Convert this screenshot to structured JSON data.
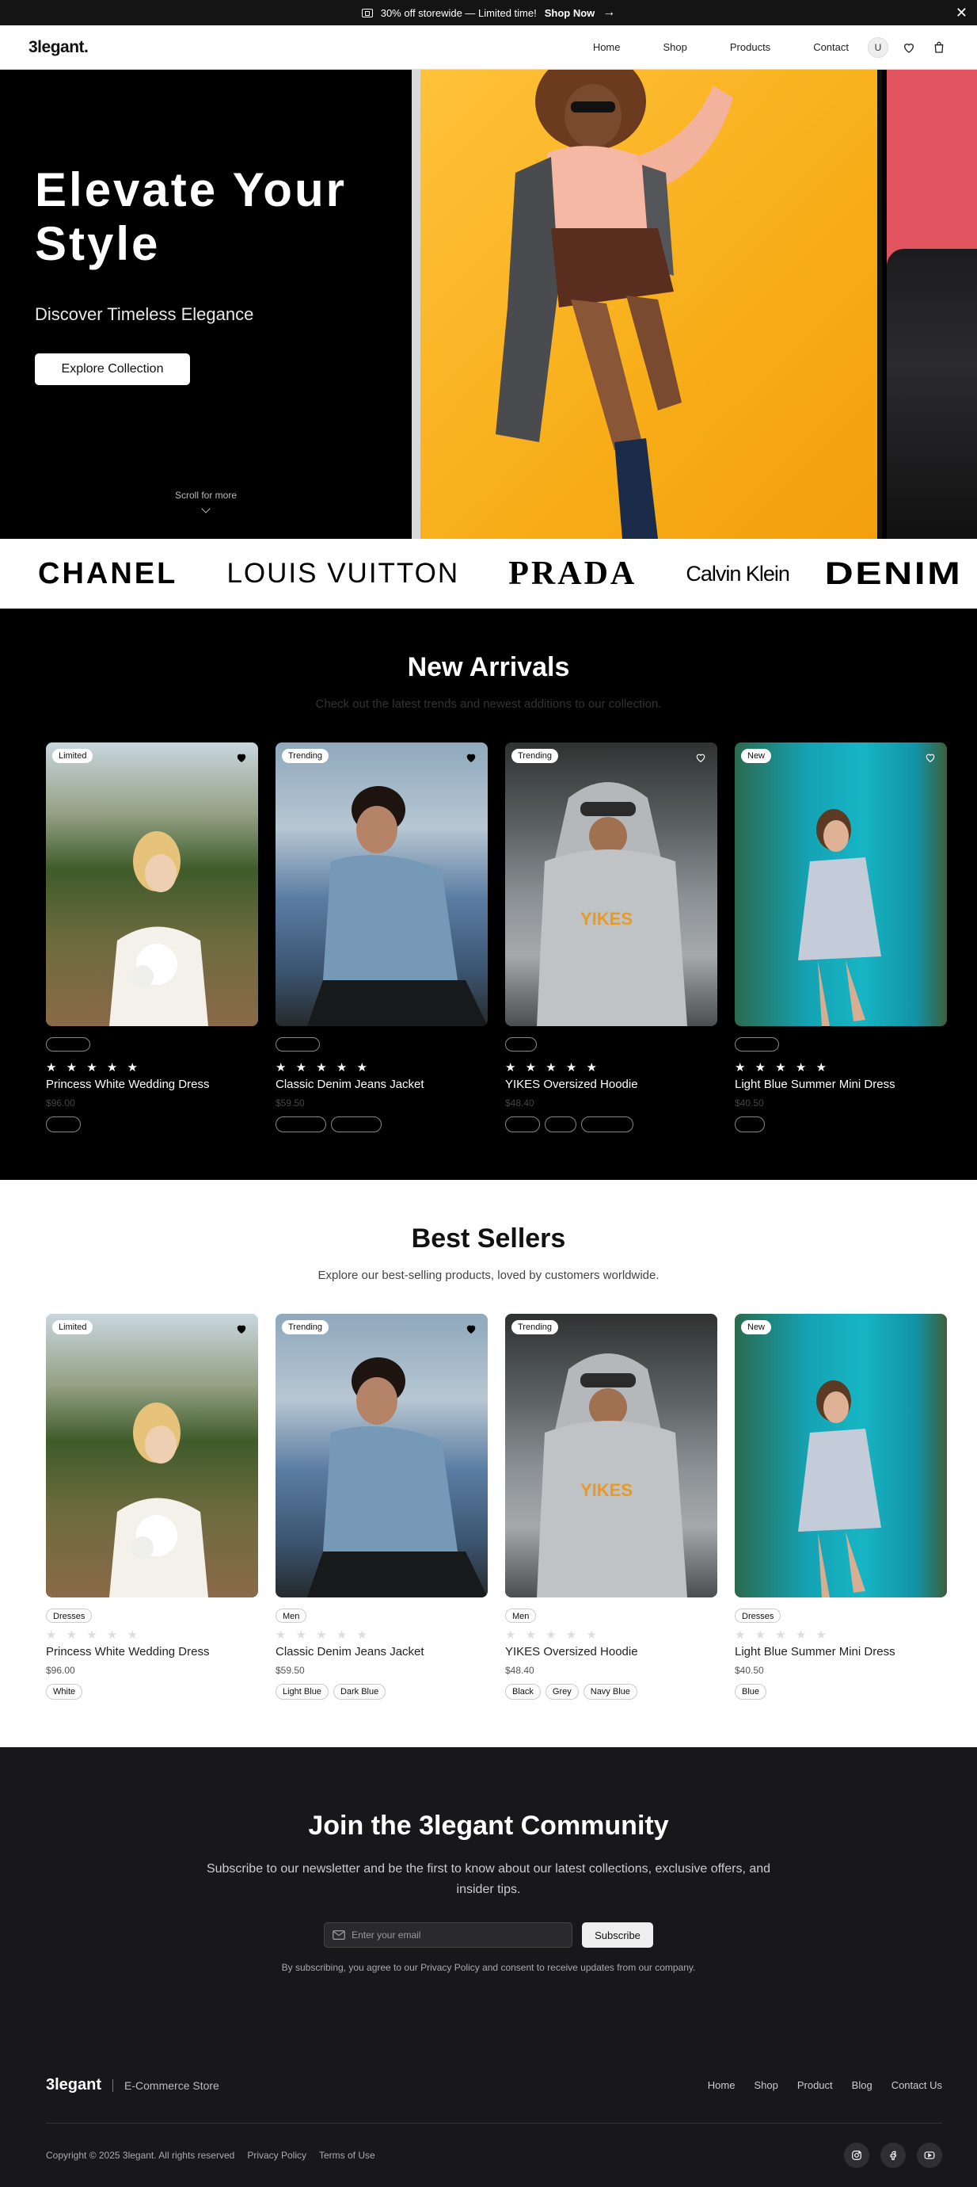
{
  "announcement": {
    "text": "30% off storewide — Limited time!",
    "link": "Shop Now",
    "arrow": "→",
    "close": "✕"
  },
  "nav": {
    "logo": "3legant.",
    "links": [
      "Home",
      "Shop",
      "Products",
      "Contact"
    ],
    "avatar": "U"
  },
  "hero": {
    "title": "Elevate Your Style",
    "subtitle": "Discover Timeless Elegance",
    "button": "Explore Collection",
    "scroll": "Scroll for more"
  },
  "brands": [
    "CHANEL",
    "LOUIS VUITTON",
    "PRADA",
    "Calvin Klein",
    "DENIM"
  ],
  "new_arrivals": {
    "title": "New Arrivals",
    "subtitle": "Check out the latest trends and newest additions to our collection.",
    "stars": "★ ★ ★ ★ ★",
    "products": [
      {
        "badge": "Limited",
        "name": "Princess White Wedding Dress",
        "price": "$96.00",
        "colors": 1
      },
      {
        "badge": "Trending",
        "name": "Classic Denim Jeans Jacket",
        "price": "$59.50",
        "colors": 2
      },
      {
        "badge": "Trending",
        "name": "YIKES Oversized Hoodie",
        "price": "$48.40",
        "colors": 3
      },
      {
        "badge": "New",
        "name": "Light Blue Summer Mini Dress",
        "price": "$40.50",
        "colors": 1
      }
    ]
  },
  "best_sellers": {
    "title": "Best Sellers",
    "subtitle": "Explore our best-selling products, loved by customers worldwide.",
    "stars": "★ ★ ★ ★ ★",
    "products": [
      {
        "badge": "Limited",
        "category": "Dresses",
        "name": "Princess White Wedding Dress",
        "price": "$96.00",
        "colors": [
          "White"
        ]
      },
      {
        "badge": "Trending",
        "category": "Men",
        "name": "Classic Denim Jeans Jacket",
        "price": "$59.50",
        "colors": [
          "Light Blue",
          "Dark Blue"
        ]
      },
      {
        "badge": "Trending",
        "category": "Men",
        "name": "YIKES Oversized Hoodie",
        "price": "$48.40",
        "colors": [
          "Black",
          "Grey",
          "Navy Blue"
        ]
      },
      {
        "badge": "New",
        "category": "Dresses",
        "name": "Light Blue Summer Mini Dress",
        "price": "$40.50",
        "colors": [
          "Blue"
        ]
      }
    ]
  },
  "newsletter": {
    "title": "Join the 3legant Community",
    "text": "Subscribe to our newsletter and be the first to know about our latest collections, exclusive offers, and insider tips.",
    "placeholder": "Enter your email",
    "button": "Subscribe",
    "note": "By subscribing, you agree to our Privacy Policy and consent to receive updates from our company."
  },
  "footer": {
    "logo": "3legant",
    "tagline": "E-Commerce Store",
    "links": [
      "Home",
      "Shop",
      "Product",
      "Blog",
      "Contact Us"
    ],
    "copyright": "Copyright © 2025 3legant. All rights reserved",
    "privacy": "Privacy Policy",
    "terms": "Terms of Use",
    "social": [
      "instagram-icon",
      "facebook-icon",
      "youtube-icon"
    ]
  }
}
